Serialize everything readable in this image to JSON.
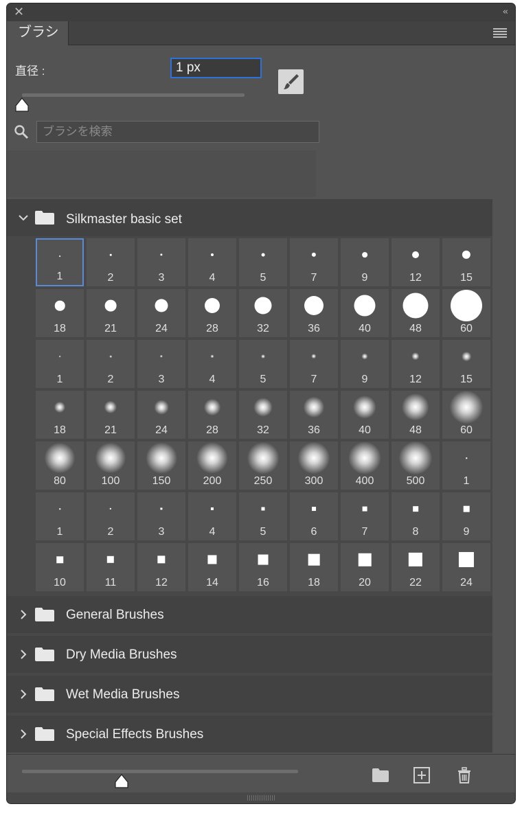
{
  "window": {
    "close_glyph": "✕",
    "collapse_glyph": "‹‹"
  },
  "tab": {
    "label": "ブラシ"
  },
  "diameter": {
    "label": "直径 :",
    "value": "1 px",
    "slider_level": 0.0
  },
  "search": {
    "placeholder": "ブラシを検索"
  },
  "groups": [
    {
      "label": "Silkmaster basic set",
      "expanded": true
    },
    {
      "label": "General Brushes",
      "expanded": false
    },
    {
      "label": "Dry Media Brushes",
      "expanded": false
    },
    {
      "label": "Wet Media Brushes",
      "expanded": false
    },
    {
      "label": "Special Effects Brushes",
      "expanded": false
    }
  ],
  "brushes": [
    {
      "n": "1",
      "k": "hard"
    },
    {
      "n": "2",
      "k": "hard"
    },
    {
      "n": "3",
      "k": "hard"
    },
    {
      "n": "4",
      "k": "hard"
    },
    {
      "n": "5",
      "k": "hard"
    },
    {
      "n": "7",
      "k": "hard"
    },
    {
      "n": "9",
      "k": "hard"
    },
    {
      "n": "12",
      "k": "hard"
    },
    {
      "n": "15",
      "k": "hard"
    },
    {
      "n": "18",
      "k": "hard"
    },
    {
      "n": "21",
      "k": "hard"
    },
    {
      "n": "24",
      "k": "hard"
    },
    {
      "n": "28",
      "k": "hard"
    },
    {
      "n": "32",
      "k": "hard"
    },
    {
      "n": "36",
      "k": "hard"
    },
    {
      "n": "40",
      "k": "hard"
    },
    {
      "n": "48",
      "k": "hard"
    },
    {
      "n": "60",
      "k": "hard"
    },
    {
      "n": "1",
      "k": "soft"
    },
    {
      "n": "2",
      "k": "soft"
    },
    {
      "n": "3",
      "k": "soft"
    },
    {
      "n": "4",
      "k": "soft"
    },
    {
      "n": "5",
      "k": "soft"
    },
    {
      "n": "7",
      "k": "soft"
    },
    {
      "n": "9",
      "k": "soft"
    },
    {
      "n": "12",
      "k": "soft"
    },
    {
      "n": "15",
      "k": "soft"
    },
    {
      "n": "18",
      "k": "soft"
    },
    {
      "n": "21",
      "k": "soft"
    },
    {
      "n": "24",
      "k": "soft"
    },
    {
      "n": "28",
      "k": "soft"
    },
    {
      "n": "32",
      "k": "soft"
    },
    {
      "n": "36",
      "k": "soft"
    },
    {
      "n": "40",
      "k": "soft"
    },
    {
      "n": "48",
      "k": "soft"
    },
    {
      "n": "60",
      "k": "soft"
    },
    {
      "n": "80",
      "k": "soft"
    },
    {
      "n": "100",
      "k": "soft"
    },
    {
      "n": "150",
      "k": "soft"
    },
    {
      "n": "200",
      "k": "soft"
    },
    {
      "n": "250",
      "k": "soft"
    },
    {
      "n": "300",
      "k": "soft"
    },
    {
      "n": "400",
      "k": "soft"
    },
    {
      "n": "500",
      "k": "soft"
    },
    {
      "n": "1",
      "k": "square"
    },
    {
      "n": "1",
      "k": "square"
    },
    {
      "n": "2",
      "k": "square"
    },
    {
      "n": "3",
      "k": "square"
    },
    {
      "n": "4",
      "k": "square"
    },
    {
      "n": "5",
      "k": "square"
    },
    {
      "n": "6",
      "k": "square"
    },
    {
      "n": "7",
      "k": "square"
    },
    {
      "n": "8",
      "k": "square"
    },
    {
      "n": "9",
      "k": "square"
    },
    {
      "n": "10",
      "k": "square"
    },
    {
      "n": "11",
      "k": "square"
    },
    {
      "n": "12",
      "k": "square"
    },
    {
      "n": "14",
      "k": "square"
    },
    {
      "n": "16",
      "k": "square"
    },
    {
      "n": "18",
      "k": "square"
    },
    {
      "n": "20",
      "k": "square"
    },
    {
      "n": "22",
      "k": "square"
    },
    {
      "n": "24",
      "k": "square"
    }
  ],
  "selected_brush_index": 0,
  "preview_size_slider_level": 0.36,
  "colors": {
    "panel": "#535353",
    "selection": "#5a8ad6",
    "input_focus": "#2d72d8"
  }
}
